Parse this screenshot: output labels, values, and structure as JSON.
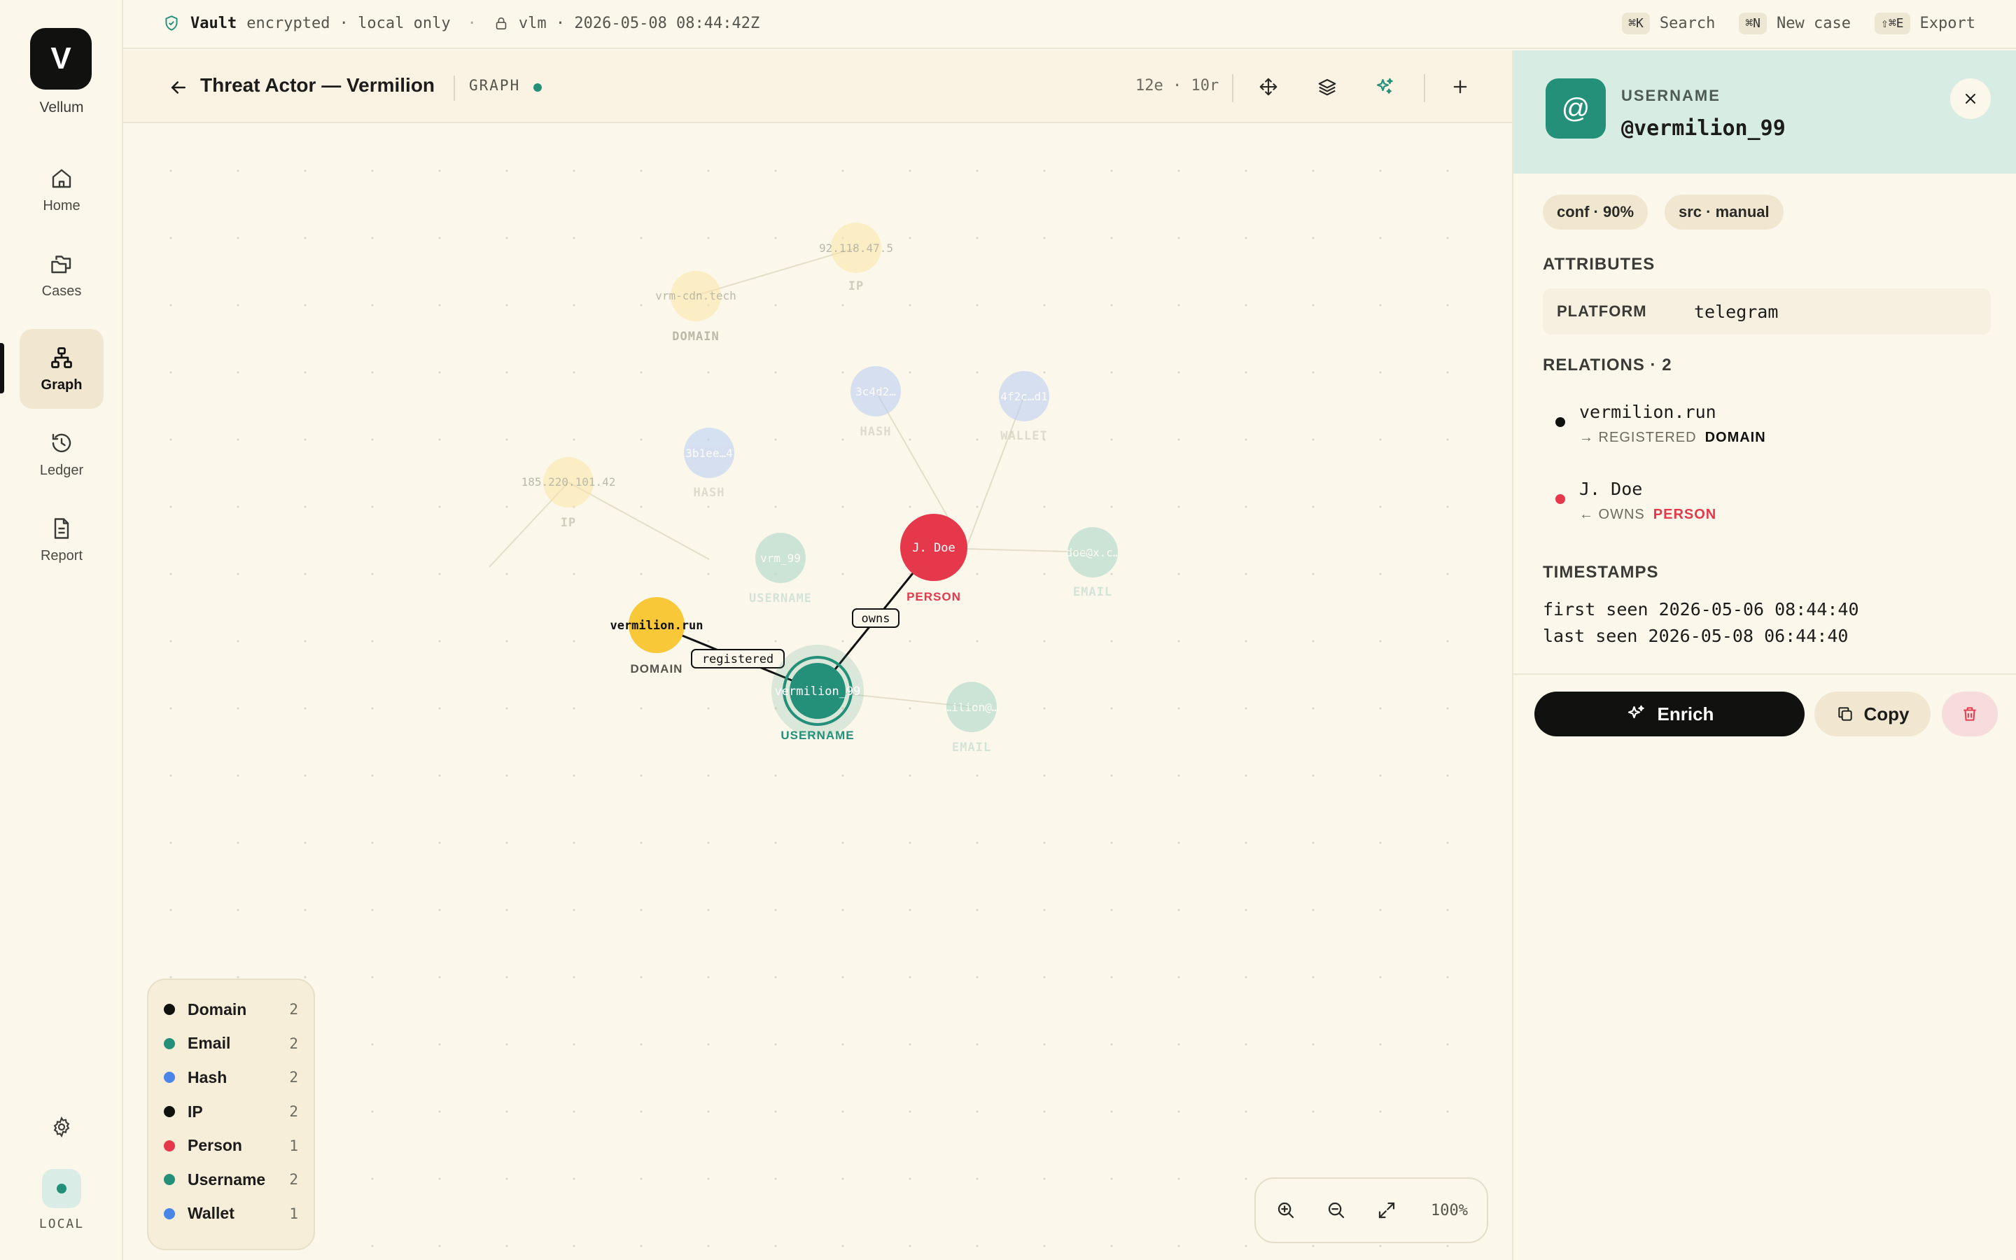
{
  "app": {
    "logo_letter": "V",
    "name": "Vellum"
  },
  "nav": [
    {
      "id": "home",
      "label": "Home",
      "icon": "home-icon"
    },
    {
      "id": "cases",
      "label": "Cases",
      "icon": "folders-icon"
    },
    {
      "id": "graph",
      "label": "Graph",
      "icon": "graph-icon",
      "active": true
    },
    {
      "id": "ledger",
      "label": "Ledger",
      "icon": "history-icon"
    },
    {
      "id": "report",
      "label": "Report",
      "icon": "document-icon"
    }
  ],
  "sidebar_footer": {
    "status_label": "LOCAL"
  },
  "topbar": {
    "vault_label": "Vault",
    "vault_status": "encrypted · local only",
    "separator": "·",
    "session": "vlm · 2026-05-08 08:44:42Z",
    "shortcuts": [
      {
        "keys": "⌘K",
        "label": "Search"
      },
      {
        "keys": "⌘N",
        "label": "New case"
      },
      {
        "keys": "⇧⌘E",
        "label": "Export"
      }
    ]
  },
  "graph_header": {
    "title": "Threat Actor — Vermilion",
    "view_label": "GRAPH",
    "counts": "12e · 10r"
  },
  "graph": {
    "nodes": [
      {
        "id": "ip1",
        "label": "92.118.47.5",
        "type": "IP",
        "faded": true
      },
      {
        "id": "dom2",
        "label": "vrm-cdn.tech",
        "type": "DOMAIN",
        "faded": true
      },
      {
        "id": "hash1",
        "label": "3c4d2…",
        "type": "HASH",
        "faded": true
      },
      {
        "id": "wallet1",
        "label": "4f2c…d1",
        "type": "WALLET",
        "faded": true
      },
      {
        "id": "hash2",
        "label": "3b1ee…4",
        "type": "HASH",
        "faded": true
      },
      {
        "id": "ip2",
        "label": "185.220.101.42",
        "type": "IP",
        "faded": true
      },
      {
        "id": "user2",
        "label": "vrm_99",
        "type": "USERNAME",
        "faded": true
      },
      {
        "id": "person",
        "label": "J. Doe",
        "type": "PERSON",
        "faded": false
      },
      {
        "id": "email1",
        "label": "doe@x.c…",
        "type": "EMAIL",
        "faded": true
      },
      {
        "id": "dom1",
        "label": "vermilion.run",
        "type": "DOMAIN",
        "faded": false
      },
      {
        "id": "user1",
        "label": "vermilion_99",
        "type": "USERNAME",
        "faded": false,
        "selected": true
      },
      {
        "id": "email2",
        "label": "…ilion@…",
        "type": "EMAIL",
        "faded": true
      }
    ],
    "edges": [
      {
        "from": "dom1",
        "to": "user1",
        "label": "registered"
      },
      {
        "from": "user1",
        "to": "person",
        "label": "owns"
      }
    ]
  },
  "legend": [
    {
      "label": "Domain",
      "count": "2",
      "color": "#111110"
    },
    {
      "label": "Email",
      "count": "2",
      "color": "#24907a"
    },
    {
      "label": "Hash",
      "count": "2",
      "color": "#4a86e8"
    },
    {
      "label": "IP",
      "count": "2",
      "color": "#111110"
    },
    {
      "label": "Person",
      "count": "1",
      "color": "#e5384b"
    },
    {
      "label": "Username",
      "count": "2",
      "color": "#24907a"
    },
    {
      "label": "Wallet",
      "count": "1",
      "color": "#4a86e8"
    }
  ],
  "zoom": {
    "level": "100%"
  },
  "panel": {
    "entity_icon": "@",
    "entity_type": "USERNAME",
    "entity_value": "@vermilion_99",
    "chips": [
      "conf · 90%",
      "src · manual"
    ],
    "attributes_title": "ATTRIBUTES",
    "attributes": [
      {
        "key": "PLATFORM",
        "value": "telegram"
      }
    ],
    "relations_title": "RELATIONS · 2",
    "relations": [
      {
        "name": "vermilion.run",
        "direction": "→ REGISTERED",
        "type": "DOMAIN",
        "color": "#111110"
      },
      {
        "name": "J. Doe",
        "direction": "← OWNS",
        "type": "PERSON",
        "color": "#e5384b"
      }
    ],
    "timestamps_title": "TIMESTAMPS",
    "first_seen": "first seen 2026-05-06 08:44:40",
    "last_seen": "last seen 2026-05-08 06:44:40",
    "actions": {
      "enrich": "Enrich",
      "copy": "Copy"
    }
  }
}
